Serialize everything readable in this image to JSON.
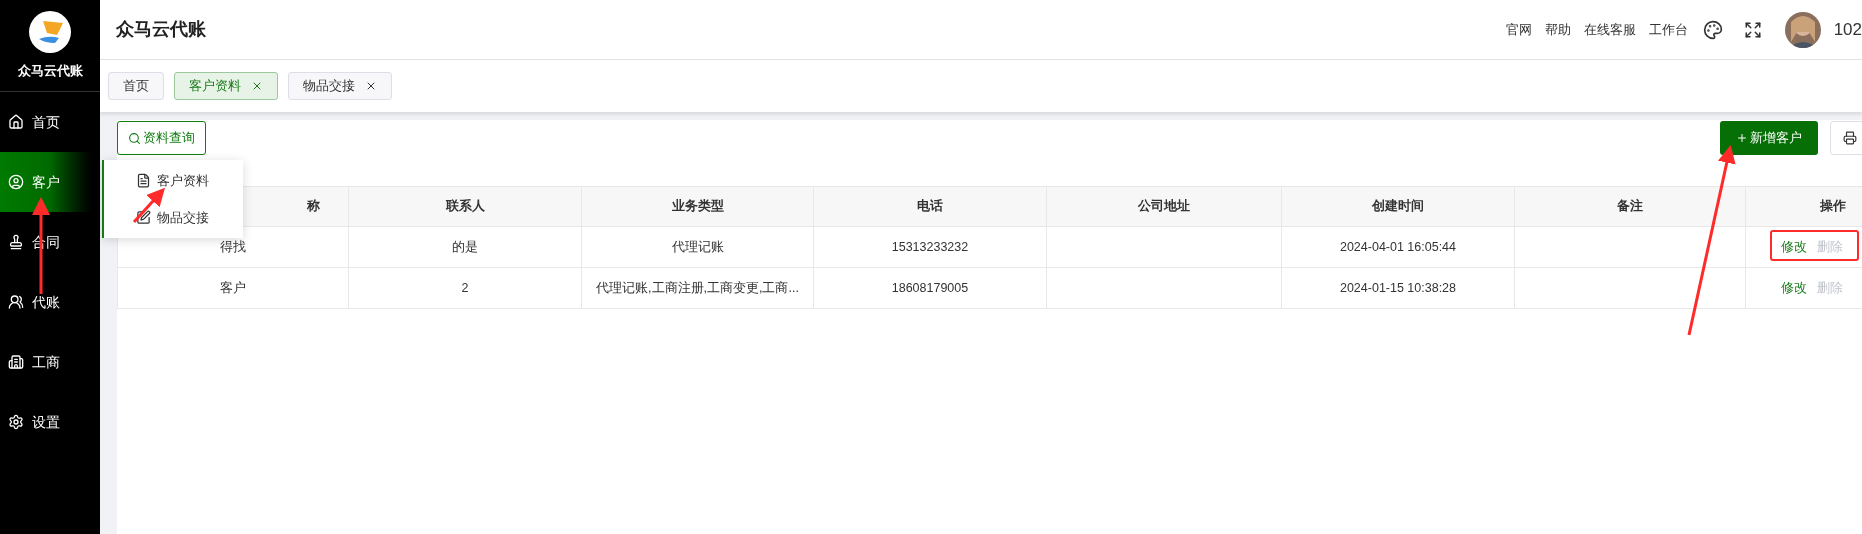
{
  "sidebar": {
    "brand": "众马云代账",
    "items": [
      {
        "label": "首页",
        "selected": false
      },
      {
        "label": "客户",
        "selected": true
      },
      {
        "label": "合同",
        "selected": false
      },
      {
        "label": "代账",
        "selected": false
      },
      {
        "label": "工商",
        "selected": false
      },
      {
        "label": "设置",
        "selected": false
      }
    ]
  },
  "submenu": [
    {
      "label": "客户资料"
    },
    {
      "label": "物品交接"
    }
  ],
  "header": {
    "title": "众马云代账",
    "links": [
      "官网",
      "帮助",
      "在线客服",
      "工作台"
    ],
    "user": "102"
  },
  "tabs": [
    {
      "label": "首页",
      "selected": false,
      "closable": false
    },
    {
      "label": "客户资料",
      "selected": true,
      "closable": true
    },
    {
      "label": "物品交接",
      "selected": false,
      "closable": true
    }
  ],
  "toolbar": {
    "search_button": "资料查询",
    "add_button": "新增客户"
  },
  "table": {
    "columns": [
      "称",
      "联系人",
      "业务类型",
      "电话",
      "公司地址",
      "创建时间",
      "备注",
      "操作"
    ],
    "rows": [
      {
        "cells": [
          "得找",
          "的是",
          "代理记账",
          "15313233232",
          "",
          "2024-04-01 16:05:44",
          ""
        ],
        "actions": [
          {
            "label": "修改",
            "disabled": false
          },
          {
            "label": "删除",
            "disabled": true
          }
        ]
      },
      {
        "cells": [
          "客户",
          "2",
          "代理记账,工商注册,工商变更,工商...",
          "18608179005",
          "",
          "2024-01-15 10:38:28",
          ""
        ],
        "actions": [
          {
            "label": "修改",
            "disabled": false
          },
          {
            "label": "删除",
            "disabled": true
          }
        ]
      }
    ]
  }
}
